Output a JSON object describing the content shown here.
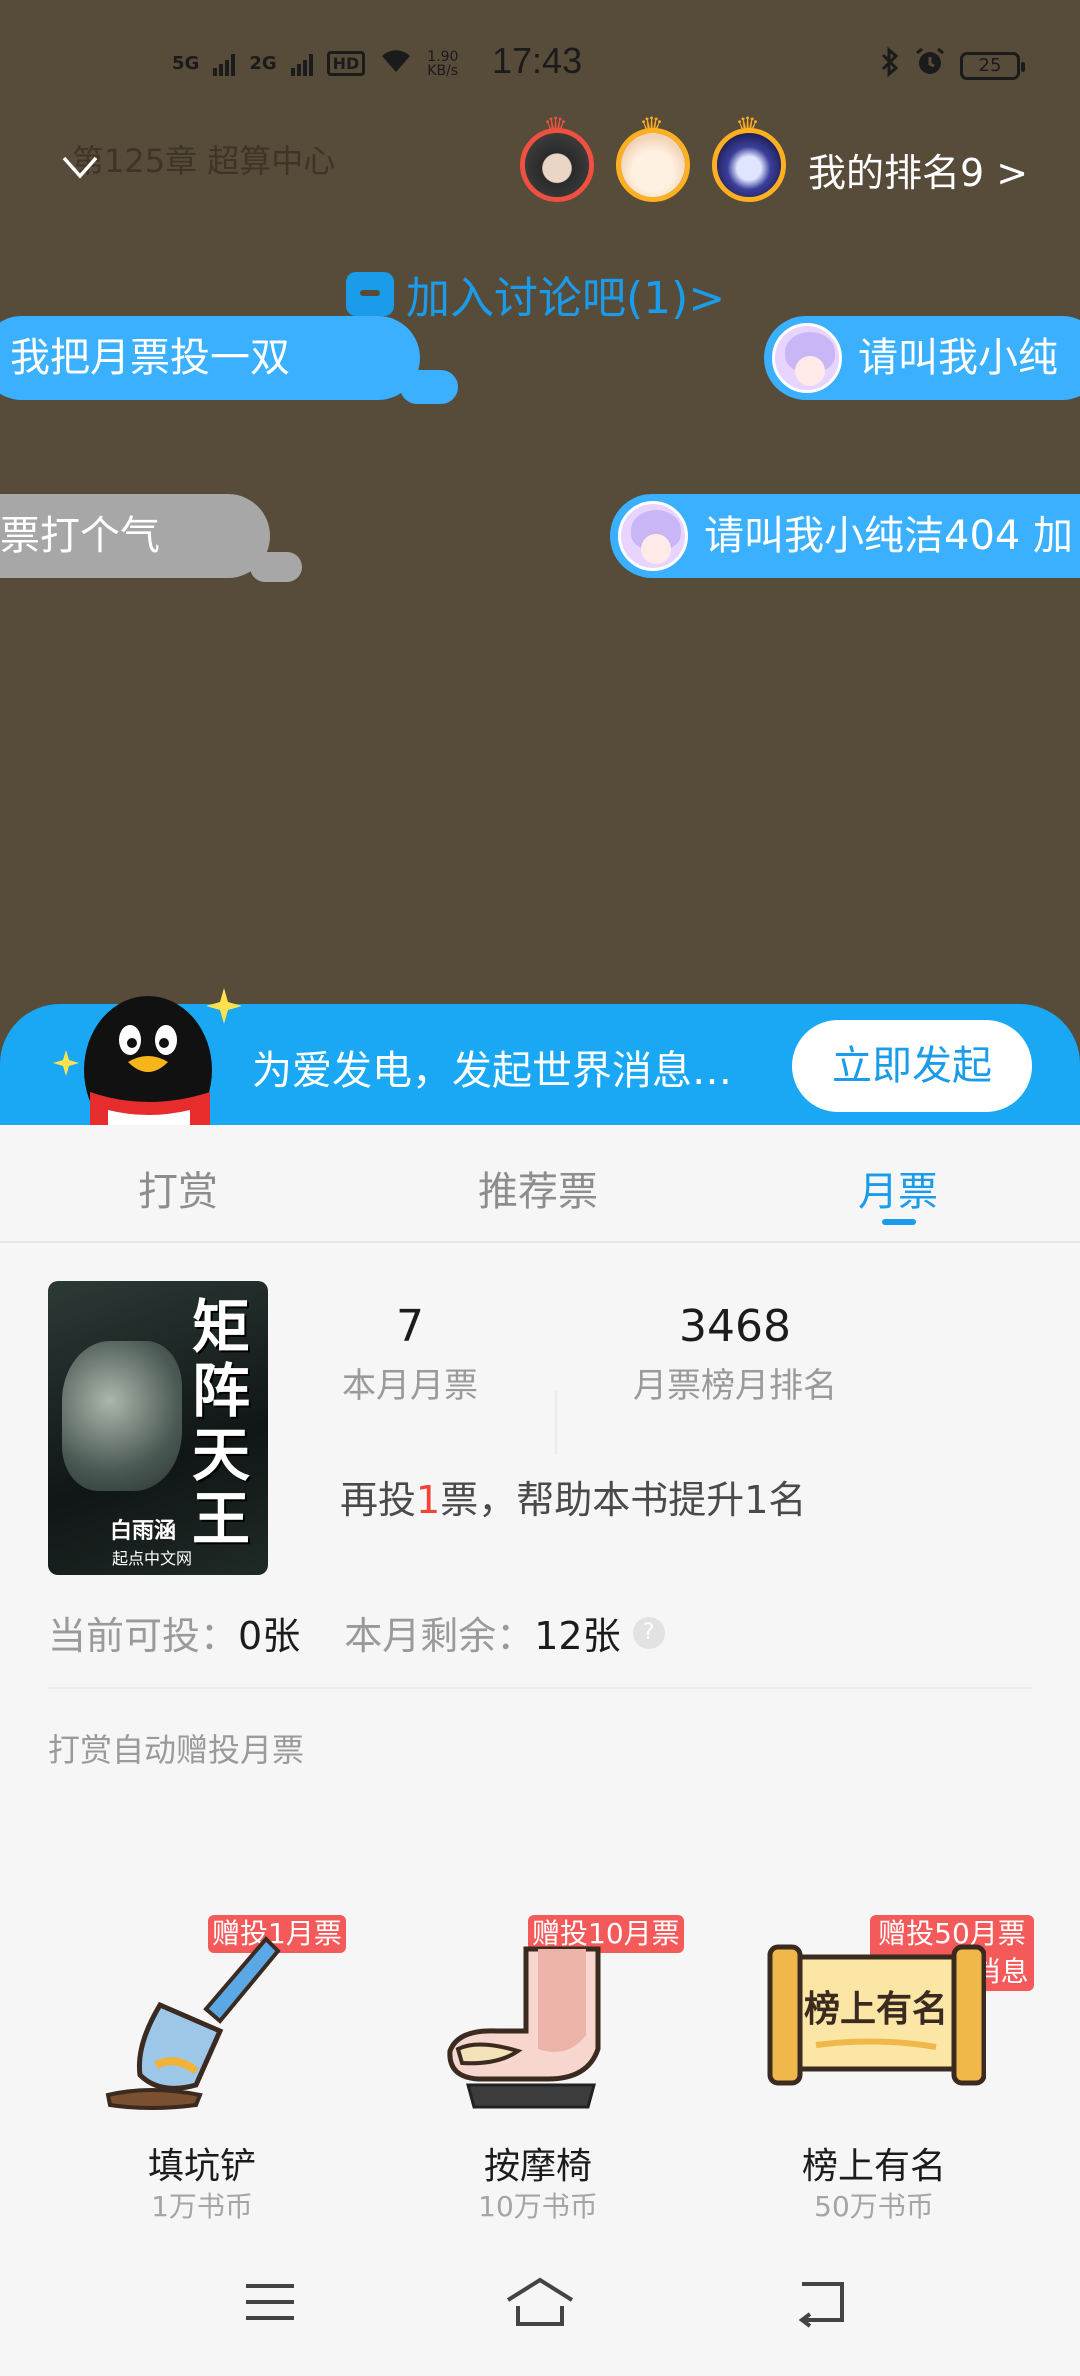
{
  "status_bar": {
    "network1": "5G",
    "network2": "2G",
    "hd": "HD",
    "speed_value": "1.90",
    "speed_unit": "KB/s",
    "time": "17:43",
    "battery": "25"
  },
  "header": {
    "chapter_title": "第125章 超算中心",
    "rank_text": "我的排名9 >"
  },
  "discussion": {
    "label": "加入讨论吧(1)>"
  },
  "danmaku": [
    {
      "text": "我把月票投一双"
    },
    {
      "text": "请叫我小纯"
    },
    {
      "text": "票打个气"
    },
    {
      "text": "请叫我小纯洁404 加"
    }
  ],
  "banner": {
    "text": "为爱发电，发起世界消息…",
    "button": "立即发起"
  },
  "tabs": [
    {
      "label": "打赏"
    },
    {
      "label": "推荐票"
    },
    {
      "label": "月票"
    }
  ],
  "book": {
    "cover_title": "矩阵天王",
    "cover_author": "白雨涵",
    "cover_publisher": "起点中文网"
  },
  "stats": {
    "monthly_votes": "7",
    "monthly_votes_label": "本月月票",
    "rank": "3468",
    "rank_label": "月票榜月排名"
  },
  "hint": {
    "prefix": "再投",
    "count": "1",
    "suffix": "票，帮助本书提升1名"
  },
  "quota": {
    "current_label": "当前可投：",
    "current_value": "0张",
    "remain_label": "本月剩余：",
    "remain_value": "12张",
    "help": "?"
  },
  "auto_vote_label": "打赏自动赠投月票",
  "gifts": [
    {
      "badge": "赠投1月票",
      "name": "填坑铲",
      "price": "1万书币"
    },
    {
      "badge": "赠投10月票",
      "name": "按摩椅",
      "price": "10万书币"
    },
    {
      "badge": "赠投50月票",
      "badge2": "+1世界消息",
      "name": "榜上有名",
      "price": "50万书币",
      "plaque": "榜上有名"
    }
  ],
  "colors": {
    "accent": "#1a9cea",
    "overlay": "#574b3a",
    "badge": "#f45a5a",
    "danmaku_blue": "#3ab0ff"
  }
}
